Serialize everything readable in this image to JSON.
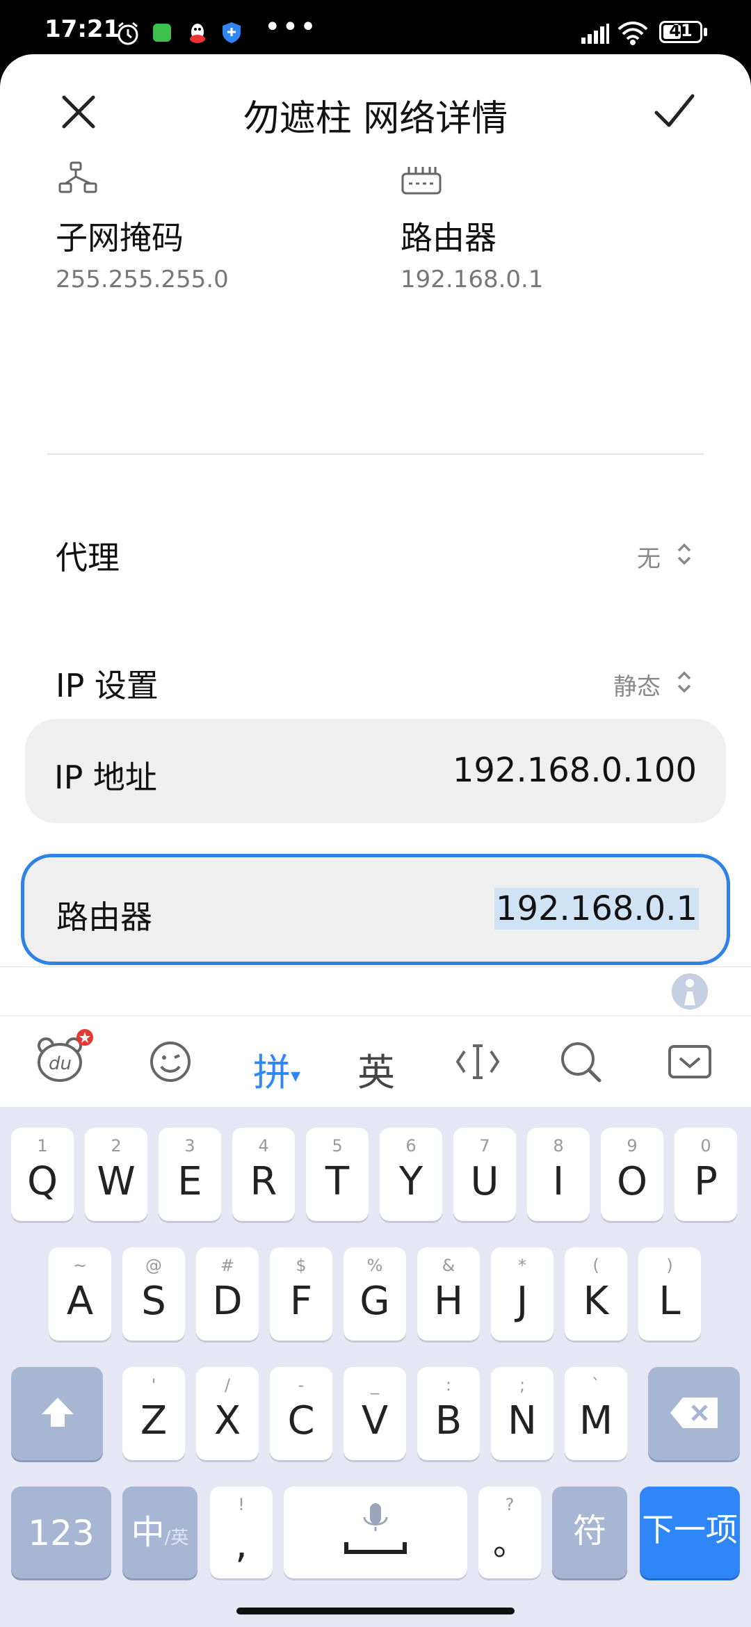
{
  "status_bar": {
    "time": "17:21",
    "battery": "41",
    "icons": [
      "alarm-icon",
      "app-icon-green",
      "qq-icon",
      "shield-icon",
      "more-dots-icon",
      "signal-icon",
      "wifi-icon",
      "battery-icon"
    ]
  },
  "header": {
    "title": "勿遮柱 网络详情",
    "close_icon": "close-icon",
    "confirm_icon": "check-icon"
  },
  "info": {
    "subnet": {
      "label": "子网掩码",
      "value": "255.255.255.0",
      "icon": "subnet-icon"
    },
    "router": {
      "label": "路由器",
      "value": "192.168.0.1",
      "icon": "router-icon"
    }
  },
  "settings": {
    "proxy": {
      "label": "代理",
      "value": "无"
    },
    "ip_settings": {
      "label": "IP 设置",
      "value": "静态"
    }
  },
  "fields": {
    "ip_address": {
      "label": "IP 地址",
      "value": "192.168.0.100"
    },
    "router": {
      "label": "路由器",
      "value": "192.168.0.1"
    }
  },
  "keyboard": {
    "toolbar": {
      "pinyin": "拼",
      "english": "英",
      "mode_caret": "▾"
    },
    "row1": [
      {
        "k": "Q",
        "h": "1"
      },
      {
        "k": "W",
        "h": "2"
      },
      {
        "k": "E",
        "h": "3"
      },
      {
        "k": "R",
        "h": "4"
      },
      {
        "k": "T",
        "h": "5"
      },
      {
        "k": "Y",
        "h": "6"
      },
      {
        "k": "U",
        "h": "7"
      },
      {
        "k": "I",
        "h": "8"
      },
      {
        "k": "O",
        "h": "9"
      },
      {
        "k": "P",
        "h": "0"
      }
    ],
    "row2": [
      {
        "k": "A",
        "h": "~"
      },
      {
        "k": "S",
        "h": "@"
      },
      {
        "k": "D",
        "h": "#"
      },
      {
        "k": "F",
        "h": "$"
      },
      {
        "k": "G",
        "h": "%"
      },
      {
        "k": "H",
        "h": "&"
      },
      {
        "k": "J",
        "h": "*"
      },
      {
        "k": "K",
        "h": "("
      },
      {
        "k": "L",
        "h": ")"
      }
    ],
    "row3": [
      {
        "k": "Z",
        "h": "'"
      },
      {
        "k": "X",
        "h": "/"
      },
      {
        "k": "C",
        "h": "-"
      },
      {
        "k": "V",
        "h": "_"
      },
      {
        "k": "B",
        "h": ":"
      },
      {
        "k": "N",
        "h": ";"
      },
      {
        "k": "M",
        "h": "`"
      }
    ],
    "bottom": {
      "num": "123",
      "lang_main": "中",
      "lang_sub": "/英",
      "comma": ",",
      "comma_hint": "!",
      "period": "。",
      "period_hint": "?",
      "symbols": "符",
      "next": "下一项"
    }
  }
}
